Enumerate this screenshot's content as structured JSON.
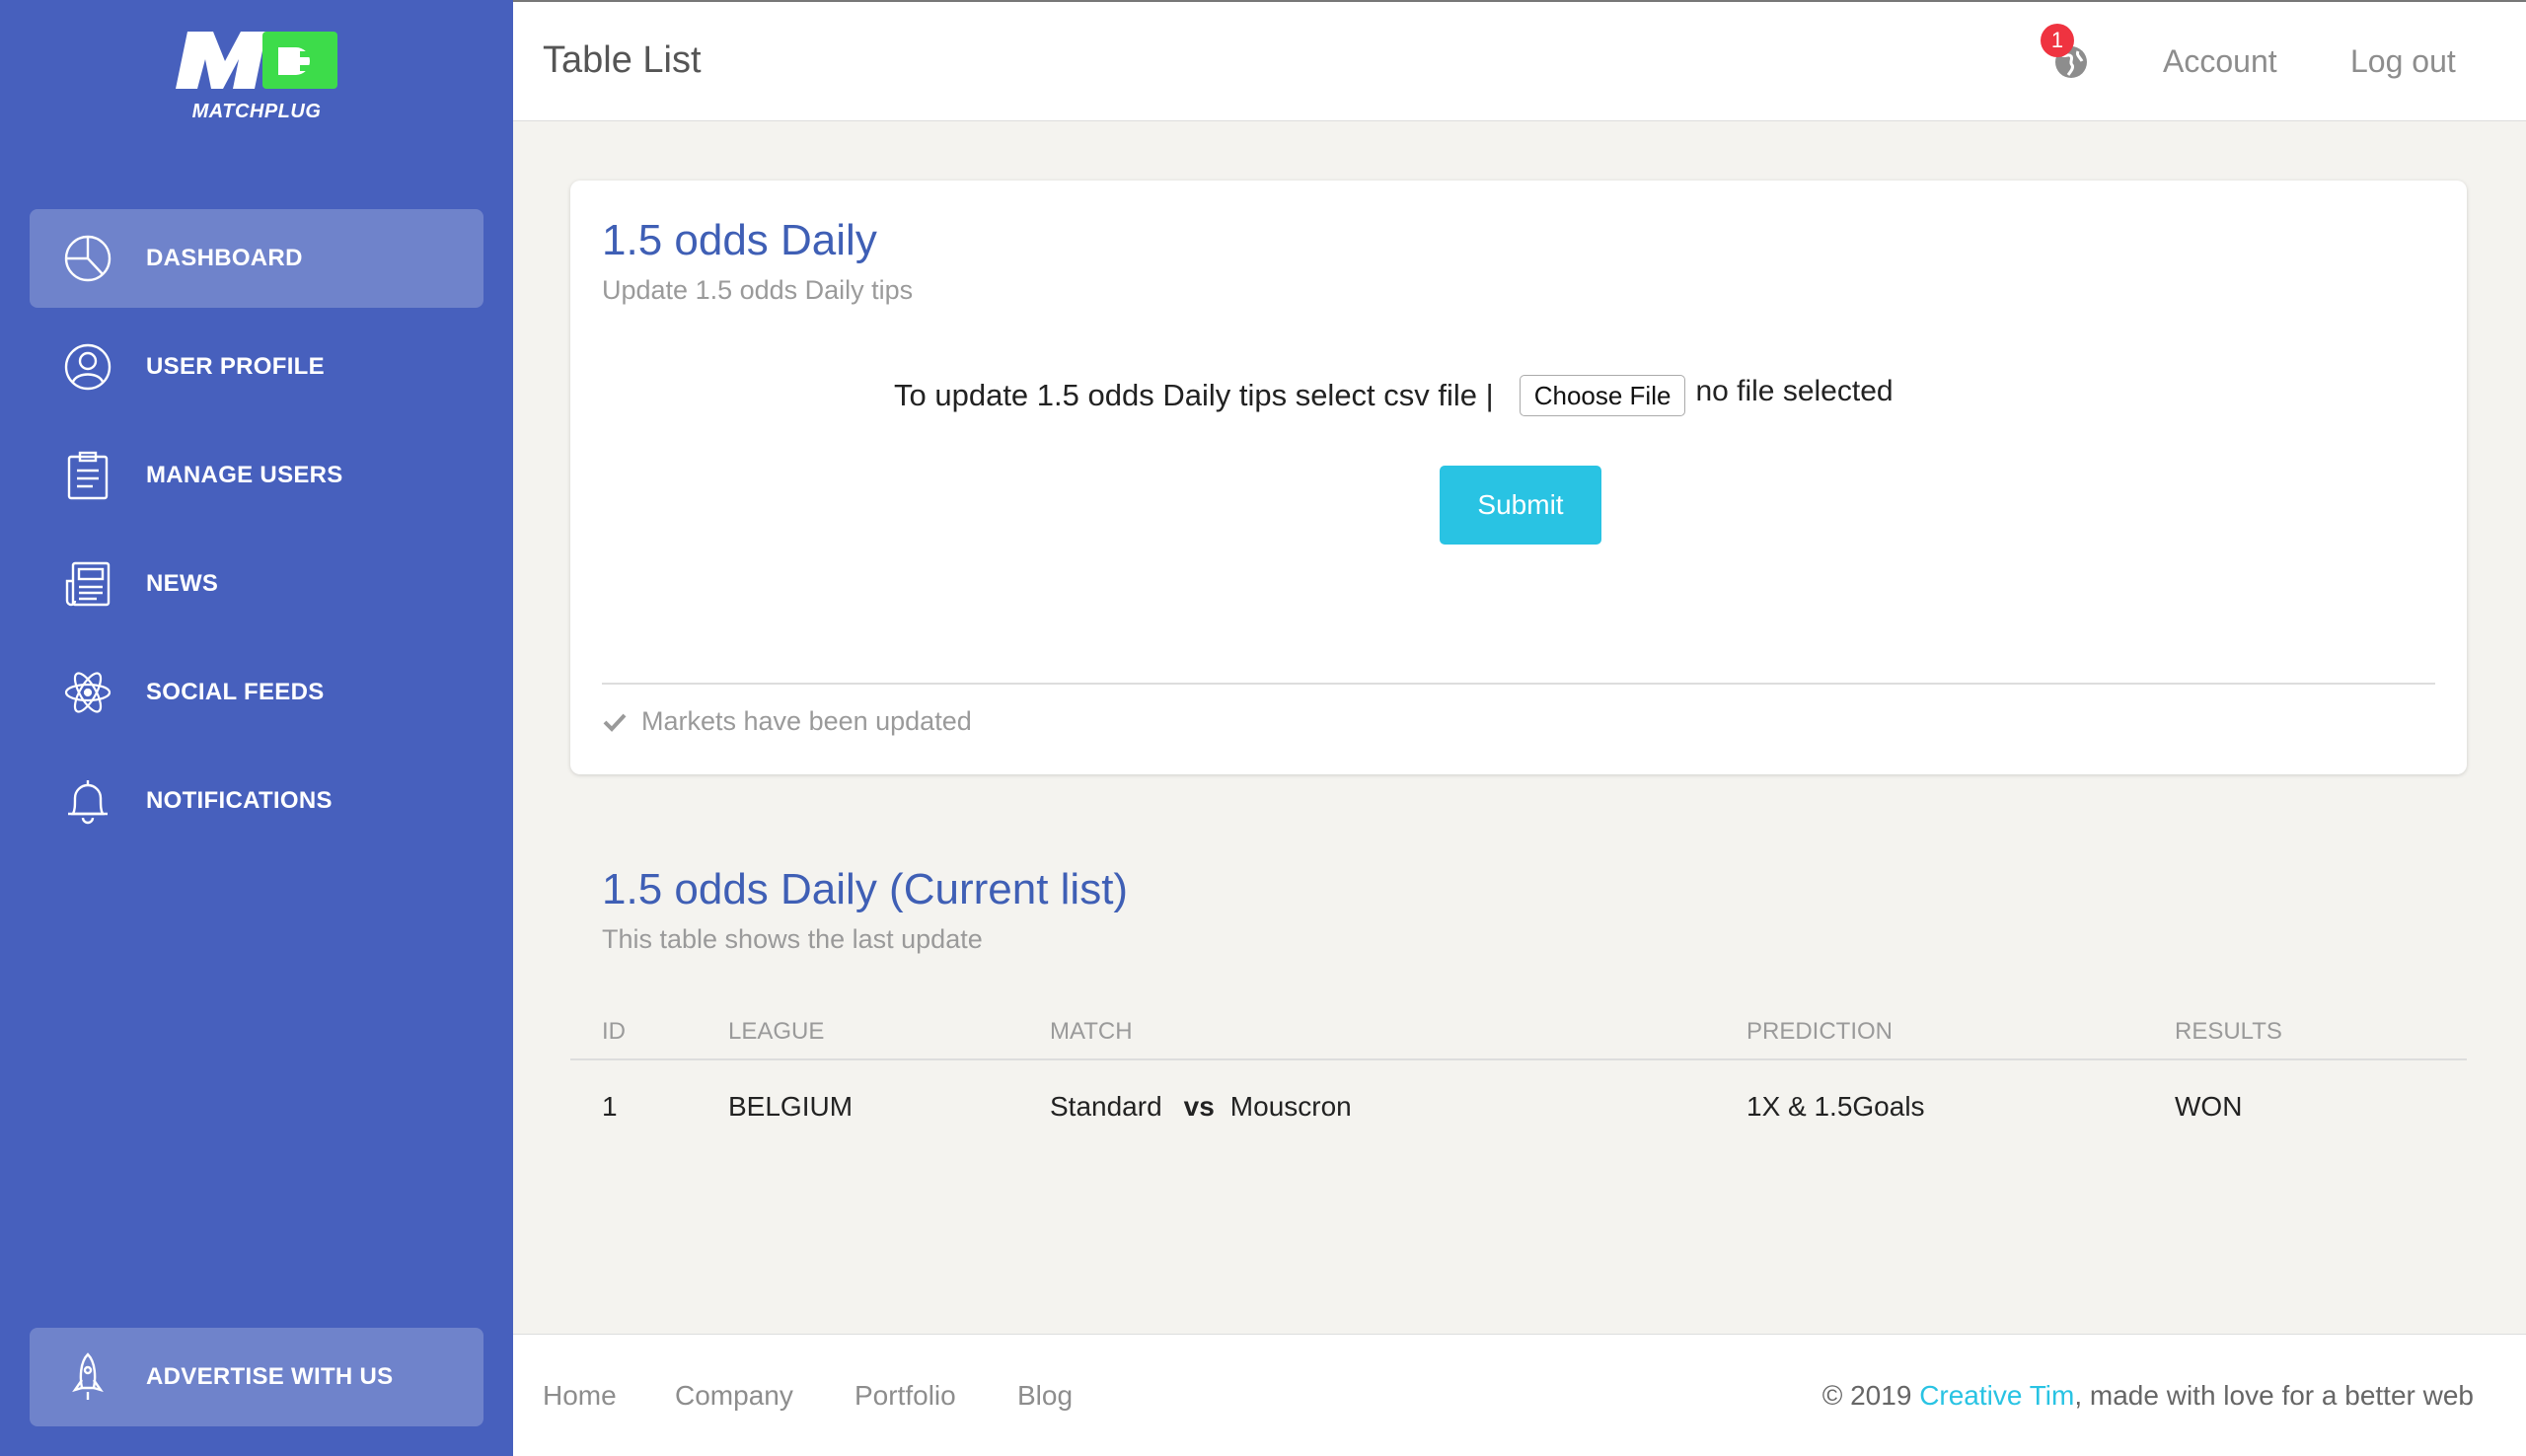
{
  "sidebar": {
    "logo_text": "MATCHPLUG",
    "items": [
      {
        "label": "DASHBOARD",
        "icon": "pie-chart-icon",
        "active": true
      },
      {
        "label": "USER PROFILE",
        "icon": "user-icon",
        "active": false
      },
      {
        "label": "MANAGE USERS",
        "icon": "clipboard-icon",
        "active": false
      },
      {
        "label": "NEWS",
        "icon": "newspaper-icon",
        "active": false
      },
      {
        "label": "SOCIAL FEEDS",
        "icon": "atom-icon",
        "active": false
      },
      {
        "label": "NOTIFICATIONS",
        "icon": "bell-icon",
        "active": false
      }
    ],
    "advertise": {
      "label": "ADVERTISE WITH US",
      "icon": "rocket-icon"
    }
  },
  "topbar": {
    "title": "Table List",
    "notification_count": "1",
    "account": "Account",
    "logout": "Log out"
  },
  "card": {
    "title": "1.5 odds Daily",
    "subtitle": "Update 1.5 odds Daily tips",
    "upload_prompt": "To update 1.5 odds Daily tips select csv file |",
    "choose_file": "Choose File",
    "no_file": "no file selected",
    "submit": "Submit",
    "status": "Markets have been updated"
  },
  "table_section": {
    "title": "1.5 odds Daily (Current list)",
    "subtitle": "This table shows the last update",
    "columns": [
      "ID",
      "LEAGUE",
      "MATCH",
      "PREDICTION",
      "RESULTS"
    ],
    "rows": [
      {
        "id": "1",
        "league": "BELGIUM",
        "home": "Standard",
        "vs": "vs",
        "away": "Mouscron",
        "prediction": "1X & 1.5Goals",
        "result": "WON"
      }
    ]
  },
  "footer": {
    "links": [
      "Home",
      "Company",
      "Portfolio",
      "Blog"
    ],
    "copyright_prefix": "© 2019 ",
    "copyright_brand": "Creative Tim",
    "copyright_suffix": ", made with love for a better web"
  },
  "colors": {
    "sidebar": "#4760bd",
    "accent": "#3f5fb5",
    "button": "#29c3e3",
    "logo_green": "#3ddc4a",
    "badge": "#ef3340"
  }
}
